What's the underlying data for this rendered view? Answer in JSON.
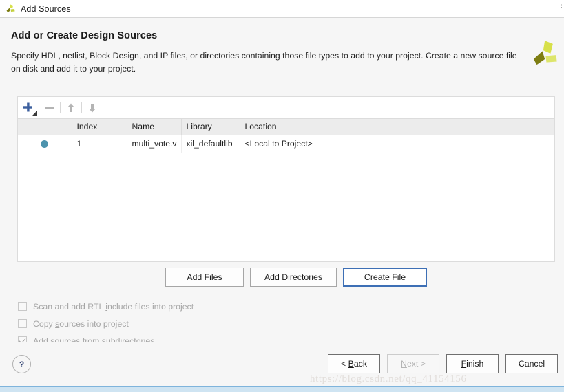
{
  "window": {
    "title": "Add Sources",
    "icon": "xilinx-logo-icon",
    "close_label": "⋮"
  },
  "header": {
    "title": "Add or Create Design Sources",
    "description": "Specify HDL, netlist, Block Design, and IP files, or directories containing those file types to add to your project. Create a new source file on disk and add it to your project.",
    "logo": "xilinx-logo-icon"
  },
  "toolbar": {
    "add_label": "+",
    "remove_label": "−",
    "move_up_label": "↑",
    "move_down_label": "↓"
  },
  "table": {
    "columns": [
      "",
      "Index",
      "Name",
      "Library",
      "Location"
    ],
    "rows": [
      {
        "status": "source-dot",
        "index": "1",
        "name": "multi_vote.v",
        "library": "xil_defaultlib",
        "location": "<Local to Project>"
      }
    ]
  },
  "actions": {
    "add_files": {
      "pre": "",
      "mnemonic": "A",
      "post": "dd Files"
    },
    "add_directories": {
      "pre": "A",
      "mnemonic": "d",
      "post": "d Directories"
    },
    "create_file": {
      "pre": "",
      "mnemonic": "C",
      "post": "reate File"
    }
  },
  "options": [
    {
      "pre": "Scan and add RTL ",
      "mnemonic": "i",
      "post": "nclude files into project",
      "checked": false,
      "enabled": false
    },
    {
      "pre": "Copy ",
      "mnemonic": "s",
      "post": "ources into project",
      "checked": false,
      "enabled": false
    },
    {
      "pre": "Add so",
      "mnemonic": "u",
      "post": "rces from subdirectories",
      "checked": true,
      "enabled": false
    }
  ],
  "footer": {
    "help_label": "?",
    "back": {
      "pre": "< ",
      "mnemonic": "B",
      "post": "ack",
      "enabled": true
    },
    "next": {
      "pre": "",
      "mnemonic": "N",
      "post": "ext >",
      "enabled": false
    },
    "finish": {
      "pre": "",
      "mnemonic": "F",
      "post": "inish",
      "enabled": true
    },
    "cancel": {
      "pre": "Cancel",
      "mnemonic": "",
      "post": "",
      "enabled": true
    }
  },
  "watermark": "https://blog.csdn.net/qq_41154156",
  "colors": {
    "accent_blue": "#3d6fb5",
    "status_dot": "#4c93ad",
    "brand_dark": "#7d7d12",
    "brand_light": "#d7e04a",
    "page_bg": "#f6f6f6",
    "header_row_bg": "#ececec"
  }
}
